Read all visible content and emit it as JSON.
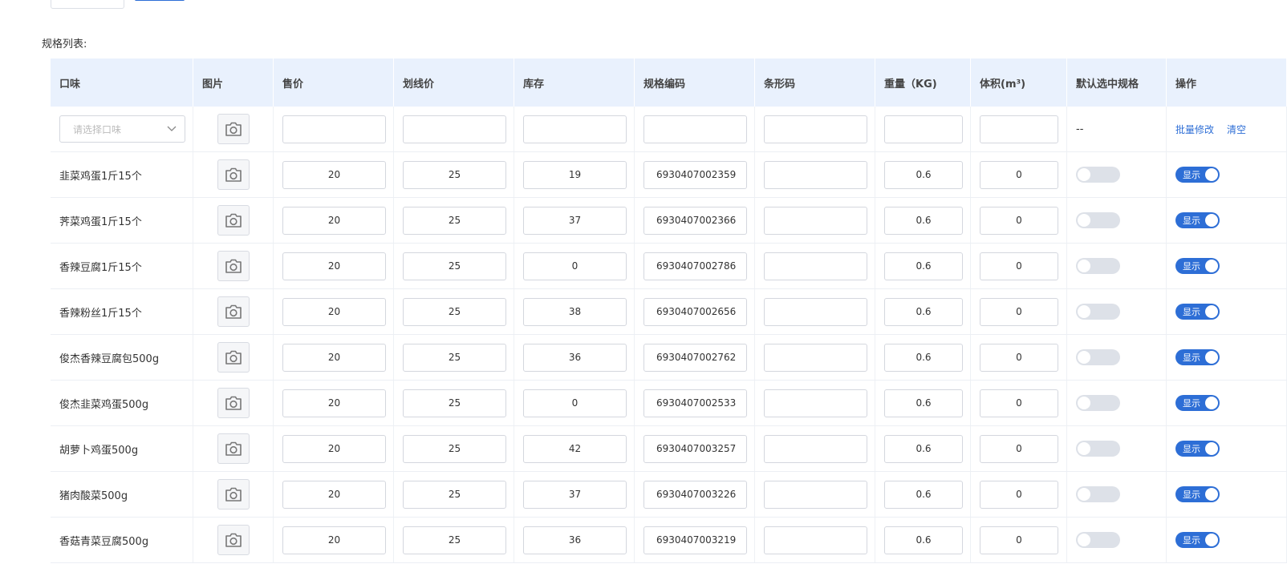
{
  "page": {
    "list_label": "规格列表:"
  },
  "columns": [
    "口味",
    "图片",
    "售价",
    "划线价",
    "库存",
    "规格编码",
    "条形码",
    "重量（KG)",
    "体积(m³)",
    "默认选中规格",
    "操作"
  ],
  "batch_row": {
    "select_placeholder": "请选择口味",
    "default_placeholder": "--",
    "actions": [
      "批量修改",
      "清空"
    ]
  },
  "rows": [
    {
      "name": "韭菜鸡蛋1斤15个",
      "price": "20",
      "list_price": "25",
      "stock": "19",
      "code": "6930407002359",
      "barcode": "",
      "weight": "0.6",
      "volume": "0",
      "default": false,
      "display": "显示"
    },
    {
      "name": "荠菜鸡蛋1斤15个",
      "price": "20",
      "list_price": "25",
      "stock": "37",
      "code": "6930407002366",
      "barcode": "",
      "weight": "0.6",
      "volume": "0",
      "default": false,
      "display": "显示"
    },
    {
      "name": "香辣豆腐1斤15个",
      "price": "20",
      "list_price": "25",
      "stock": "0",
      "code": "6930407002786",
      "barcode": "",
      "weight": "0.6",
      "volume": "0",
      "default": false,
      "display": "显示"
    },
    {
      "name": "香辣粉丝1斤15个",
      "price": "20",
      "list_price": "25",
      "stock": "38",
      "code": "6930407002656",
      "barcode": "",
      "weight": "0.6",
      "volume": "0",
      "default": false,
      "display": "显示"
    },
    {
      "name": "俊杰香辣豆腐包500g",
      "price": "20",
      "list_price": "25",
      "stock": "36",
      "code": "6930407002762",
      "barcode": "",
      "weight": "0.6",
      "volume": "0",
      "default": false,
      "display": "显示"
    },
    {
      "name": "俊杰韭菜鸡蛋500g",
      "price": "20",
      "list_price": "25",
      "stock": "0",
      "code": "6930407002533",
      "barcode": "",
      "weight": "0.6",
      "volume": "0",
      "default": false,
      "display": "显示"
    },
    {
      "name": "胡萝卜鸡蛋500g",
      "price": "20",
      "list_price": "25",
      "stock": "42",
      "code": "6930407003257",
      "barcode": "",
      "weight": "0.6",
      "volume": "0",
      "default": false,
      "display": "显示"
    },
    {
      "name": "猪肉酸菜500g",
      "price": "20",
      "list_price": "25",
      "stock": "37",
      "code": "6930407003226",
      "barcode": "",
      "weight": "0.6",
      "volume": "0",
      "default": false,
      "display": "显示"
    },
    {
      "name": "香菇青菜豆腐500g",
      "price": "20",
      "list_price": "25",
      "stock": "36",
      "code": "6930407003219",
      "barcode": "",
      "weight": "0.6",
      "volume": "0",
      "default": false,
      "display": "显示"
    }
  ],
  "colors": {
    "accent": "#2d6ed6",
    "header_bg": "#e9f1fd",
    "switch_off": "#dde1e8"
  }
}
